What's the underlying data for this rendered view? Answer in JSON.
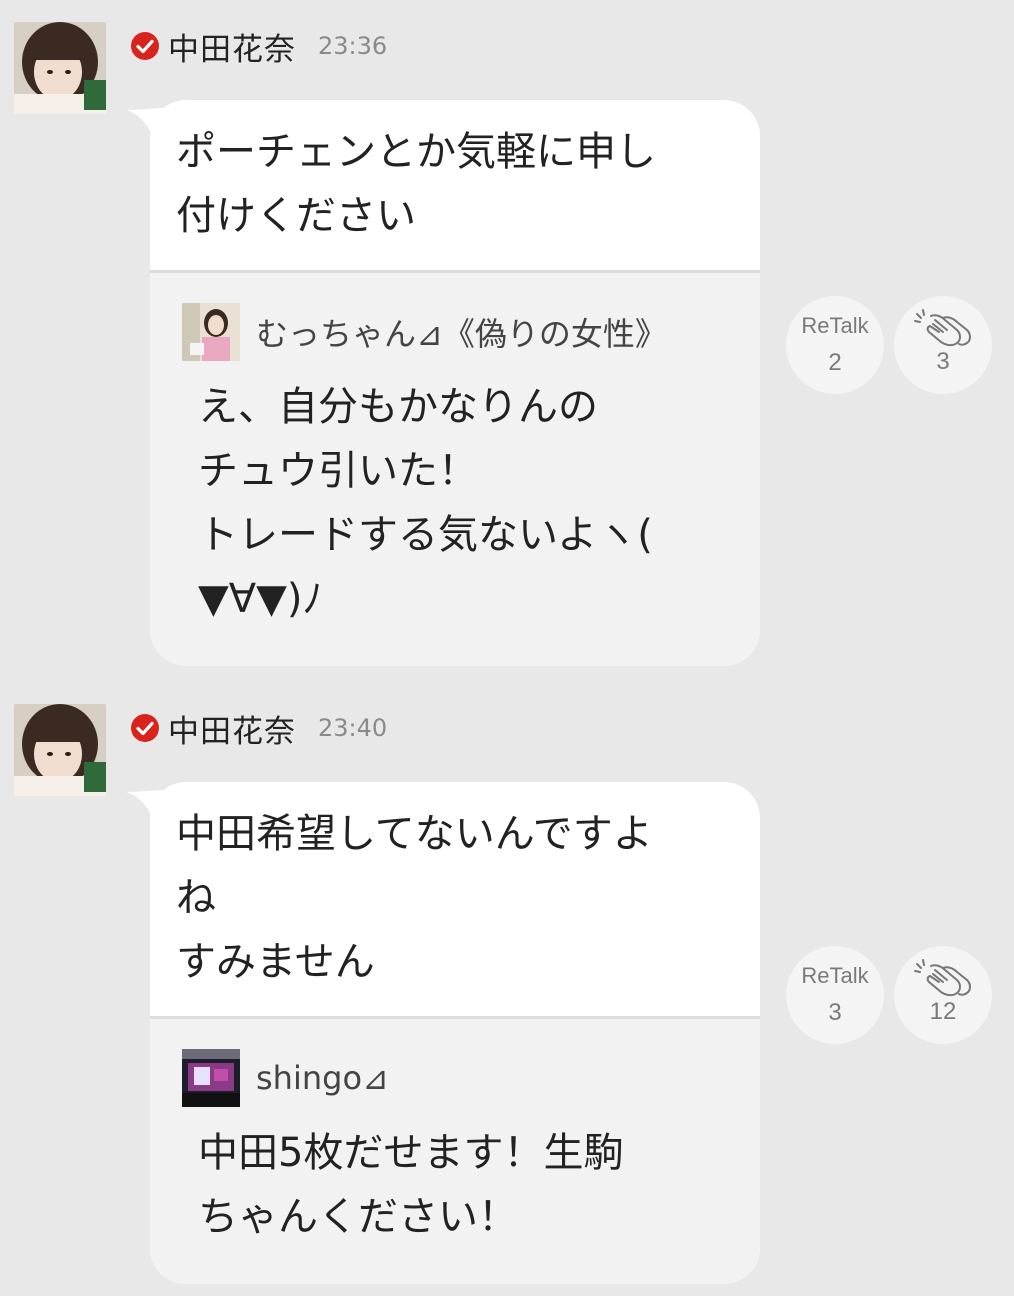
{
  "posts": [
    {
      "author": "中田花奈",
      "time": "23:36",
      "text": "ポーチェンとか気軽に申し\n付けください",
      "quote": {
        "author": "むっちゃん⊿《偽りの女性》",
        "text": "え、自分もかなりんの\nチュウ引いた！\nトレードする気ないよヽ(\n▼∀▼)ﾉ"
      },
      "retalk": {
        "label": "ReTalk",
        "count": "2"
      },
      "claps": {
        "count": "3"
      }
    },
    {
      "author": "中田花奈",
      "time": "23:40",
      "text": "中田希望してないんですよ\nね\nすみません",
      "quote": {
        "author": "shingo⊿",
        "text": "中田5枚だせます！生駒\nちゃんください！"
      },
      "retalk": {
        "label": "ReTalk",
        "count": "3"
      },
      "claps": {
        "count": "12"
      }
    }
  ],
  "icons": {
    "verified": "check-circle-icon",
    "clap": "clap-hands-icon"
  },
  "colors": {
    "verified": "#d9231d",
    "background": "#e8e8e8",
    "bubble": "#ffffff",
    "quote_bg": "#f2f2f2"
  }
}
